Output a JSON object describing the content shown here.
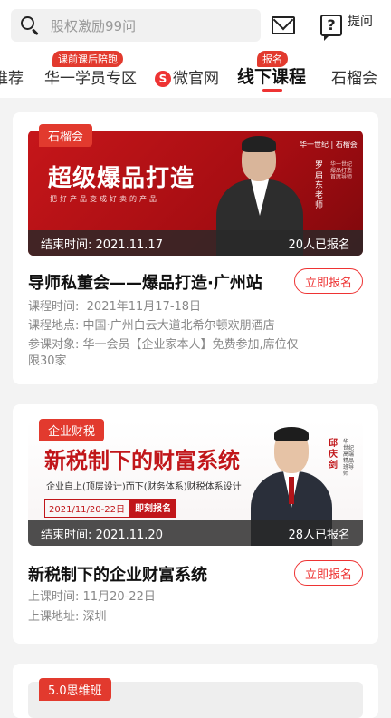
{
  "search": {
    "placeholder": "股权激励99问"
  },
  "header": {
    "ask_label": "提问",
    "ask_glyph": "?"
  },
  "tabs": [
    {
      "label": "推荐"
    },
    {
      "label": "华一学员专区",
      "badge": "课前课后陪跑"
    },
    {
      "label": "微官网",
      "icon": "S"
    },
    {
      "label": "线下课程",
      "badge": "报名",
      "active": true
    },
    {
      "label": "石榴会"
    }
  ],
  "courses": [
    {
      "tag": "石榴会",
      "banner": {
        "headline": "超级爆品打造",
        "subline": "把好产品变成好卖的产品",
        "logo": "华一世纪 | 石榴会",
        "speaker": "罗启东老师",
        "speaker_desc": "华一世纪爆品打造首席导师"
      },
      "end_label": "结束时间:",
      "end_date": "2021.11.17",
      "signed": "20人已报名",
      "title": "导师私董会——爆品打造·广州站",
      "button": "立即报名",
      "details": [
        {
          "label": "课程时间:",
          "value": "2021年11月17-18日"
        },
        {
          "label": "课程地点:",
          "value": "中国·广州白云大道北希尔顿欢朋酒店"
        },
        {
          "label": "参课对象:",
          "value": "华一会员【企业家本人】免费参加,席位仅限30家"
        }
      ]
    },
    {
      "tag": "企业财税",
      "banner": {
        "headline": "新税制下的财富系统",
        "subline": "企业自上(顶层设计)而下(财务体系)财税体系设计",
        "date": "2021/11/20-22日",
        "cta": "即刻报名",
        "speaker": "邱庆剑",
        "speaker_desc": "华一世纪高端精品班导师"
      },
      "end_label": "结束时间:",
      "end_date": "2021.11.20",
      "signed": "28人已报名",
      "title": "新税制下的企业财富系统",
      "button": "立即报名",
      "details": [
        {
          "label": "上课时间:",
          "value": "11月20-22日"
        },
        {
          "label": "上课地址:",
          "value": "深圳"
        }
      ]
    },
    {
      "tag": "5.0思维班"
    }
  ],
  "colors": {
    "accent": "#e23a2e",
    "banner_red": "#c1161a"
  }
}
